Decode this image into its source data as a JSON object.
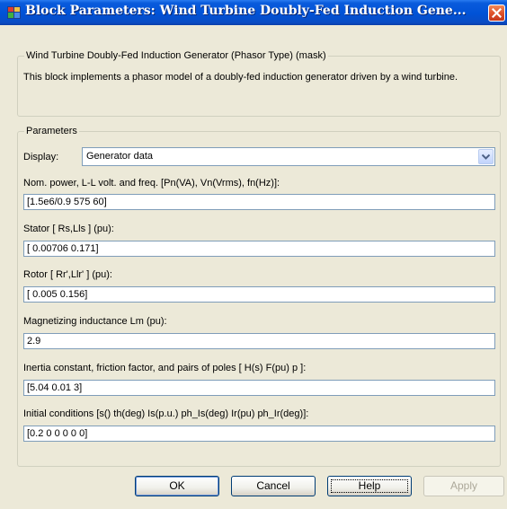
{
  "window": {
    "title": "Block Parameters: Wind Turbine Doubly-Fed Induction Gene..."
  },
  "mask": {
    "legend": "Wind Turbine Doubly-Fed Induction Generator (Phasor Type) (mask)",
    "description": "This block implements a phasor model of a doubly-fed induction generator driven by a wind turbine."
  },
  "parameters": {
    "legend": "Parameters",
    "display_label": "Display:",
    "display_value": "Generator data",
    "fields": [
      {
        "label": "Nom. power, L-L volt. and freq. [Pn(VA), Vn(Vrms), fn(Hz)]:",
        "value": "[1.5e6/0.9 575 60]"
      },
      {
        "label": "Stator [ Rs,Lls ] (pu):",
        "value": "[ 0.00706 0.171]"
      },
      {
        "label": "Rotor [ Rr',Llr' ] (pu):",
        "value": "[ 0.005 0.156]"
      },
      {
        "label": "Magnetizing inductance Lm (pu):",
        "value": "2.9"
      },
      {
        "label": "Inertia constant, friction factor, and pairs of poles [ H(s)  F(pu)  p ]:",
        "value": "[5.04 0.01 3]"
      },
      {
        "label": "Initial conditions [s()  th(deg)  Is(p.u.)  ph_Is(deg)  Ir(pu)  ph_Ir(deg)]:",
        "value": "[0.2 0 0 0 0 0]"
      }
    ]
  },
  "buttons": {
    "ok": "OK",
    "cancel": "Cancel",
    "help": "Help",
    "apply": "Apply"
  },
  "icons": {
    "app": "simulink-block-icon",
    "close": "close-icon",
    "dropdown": "chevron-down-icon"
  },
  "colors": {
    "titlebar": "#0052d6",
    "dialog_bg": "#ece9d8",
    "close_button": "#e0542c",
    "field_border": "#7f9db9"
  }
}
